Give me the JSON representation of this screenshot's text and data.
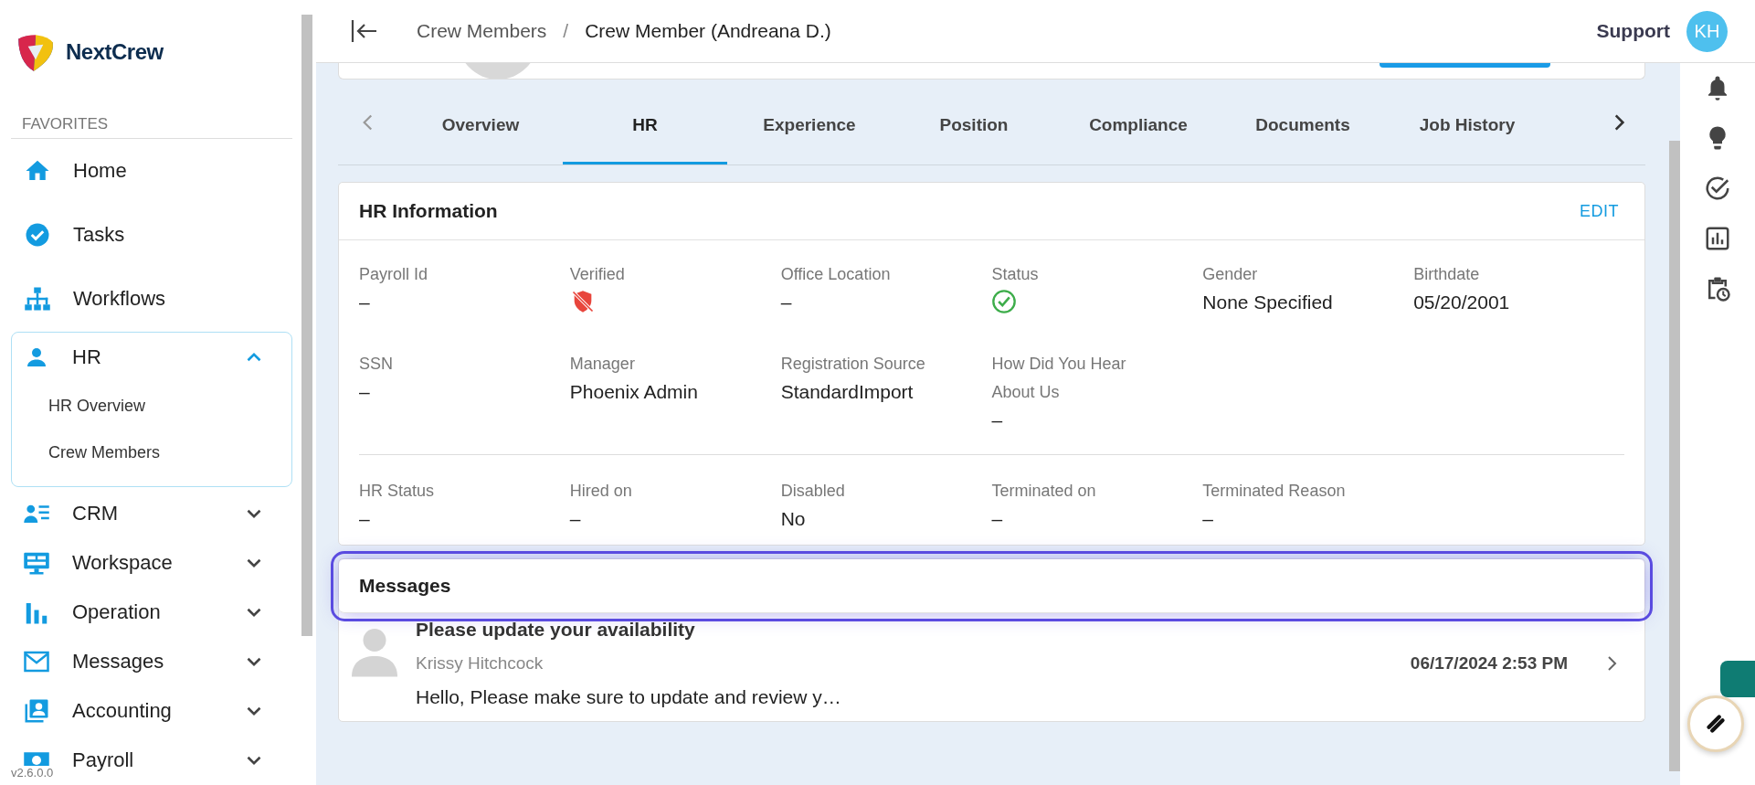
{
  "brand": {
    "name": "NextCrew"
  },
  "sidebar": {
    "section": "FAVORITES",
    "favorites": [
      {
        "label": "Home"
      },
      {
        "label": "Tasks"
      },
      {
        "label": "Workflows"
      }
    ],
    "menu": [
      {
        "label": "HR",
        "expanded": true,
        "children": [
          {
            "label": "HR Overview"
          },
          {
            "label": "Crew Members"
          }
        ]
      },
      {
        "label": "CRM",
        "expanded": false
      },
      {
        "label": "Workspace",
        "expanded": false
      },
      {
        "label": "Operation",
        "expanded": false
      },
      {
        "label": "Messages",
        "expanded": false
      },
      {
        "label": "Accounting",
        "expanded": false
      },
      {
        "label": "Payroll",
        "expanded": false
      }
    ],
    "version": "v2.6.0.0"
  },
  "header": {
    "breadcrumbs": [
      "Crew Members",
      "Crew Member (Andreana D.)"
    ],
    "separator": "/",
    "user": "Support",
    "avatar": "KH"
  },
  "tabs": [
    {
      "label": "Overview",
      "selected": false
    },
    {
      "label": "HR",
      "selected": true
    },
    {
      "label": "Experience",
      "selected": false
    },
    {
      "label": "Position",
      "selected": false
    },
    {
      "label": "Compliance",
      "selected": false
    },
    {
      "label": "Documents",
      "selected": false
    },
    {
      "label": "Job History",
      "selected": false
    }
  ],
  "hr_card": {
    "title": "HR Information",
    "action": "EDIT",
    "rows": [
      [
        {
          "label": "Payroll Id",
          "kind": "text",
          "value": "–"
        },
        {
          "label": "Verified",
          "kind": "flag",
          "on": false
        },
        {
          "label": "Office Location",
          "kind": "text",
          "value": "–"
        },
        {
          "label": "Status",
          "kind": "flag",
          "on": true
        },
        {
          "label": "Gender",
          "kind": "text",
          "value": "None Specified"
        },
        {
          "label": "Birthdate",
          "kind": "text",
          "value": "05/20/2001"
        }
      ],
      [
        {
          "label": "SSN",
          "kind": "text",
          "value": "–"
        },
        {
          "label": "Manager",
          "kind": "text",
          "value": "Phoenix Admin"
        },
        {
          "label": "Registration Source",
          "kind": "text",
          "value": "StandardImport"
        },
        {
          "label": "How Did You Hear About Us",
          "kind": "text",
          "value": "–"
        }
      ]
    ],
    "footer_row": [
      {
        "label": "HR Status",
        "kind": "text",
        "value": "–"
      },
      {
        "label": "Hired on",
        "kind": "text",
        "value": "–"
      },
      {
        "label": "Disabled",
        "kind": "text",
        "value": "No"
      },
      {
        "label": "Terminated on",
        "kind": "text",
        "value": "–"
      },
      {
        "label": "Terminated Reason",
        "kind": "text",
        "value": "–"
      }
    ]
  },
  "messages": {
    "title": "Messages",
    "highlighted": true,
    "items": [
      {
        "subject": "Please update your availability",
        "sender": "Krissy Hitchcock",
        "date": "06/17/2024 2:53 PM",
        "preview": "Hello, Please make sure to update and review y…"
      }
    ]
  }
}
